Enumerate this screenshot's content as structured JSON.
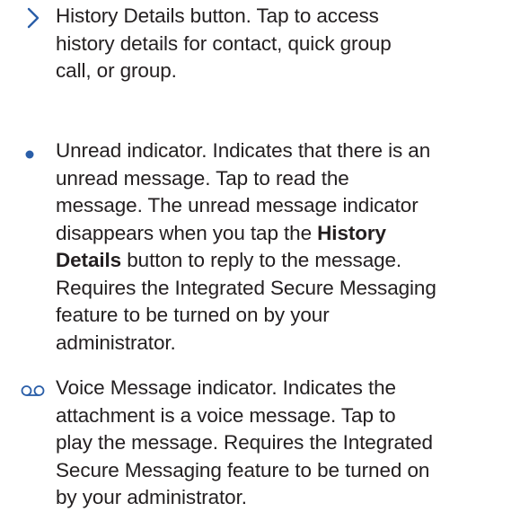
{
  "entries": [
    {
      "icon": "chevron-right-icon",
      "lines": [
        "History Details button. Tap to access",
        "history details for contact, quick group",
        "call, or group."
      ]
    },
    {
      "icon": "unread-dot-icon",
      "lines": [
        "Unread indicator. Indicates that there is an",
        "unread message. Tap to read the",
        "message. The unread message indicator",
        "disappears when you tap the ",
        "History",
        "Details",
        " button to reply to the message.",
        "Requires the Integrated Secure Messaging",
        "feature to be turned on by your",
        "administrator."
      ]
    },
    {
      "icon": "voicemail-icon",
      "lines": [
        "Voice Message indicator. Indicates the",
        "attachment is a voice message. Tap to",
        "play the message. Requires the Integrated",
        "Secure Messaging feature to be turned on",
        "by your administrator."
      ]
    }
  ],
  "colors": {
    "accent": "#2a5ea8",
    "text": "#231f20"
  }
}
